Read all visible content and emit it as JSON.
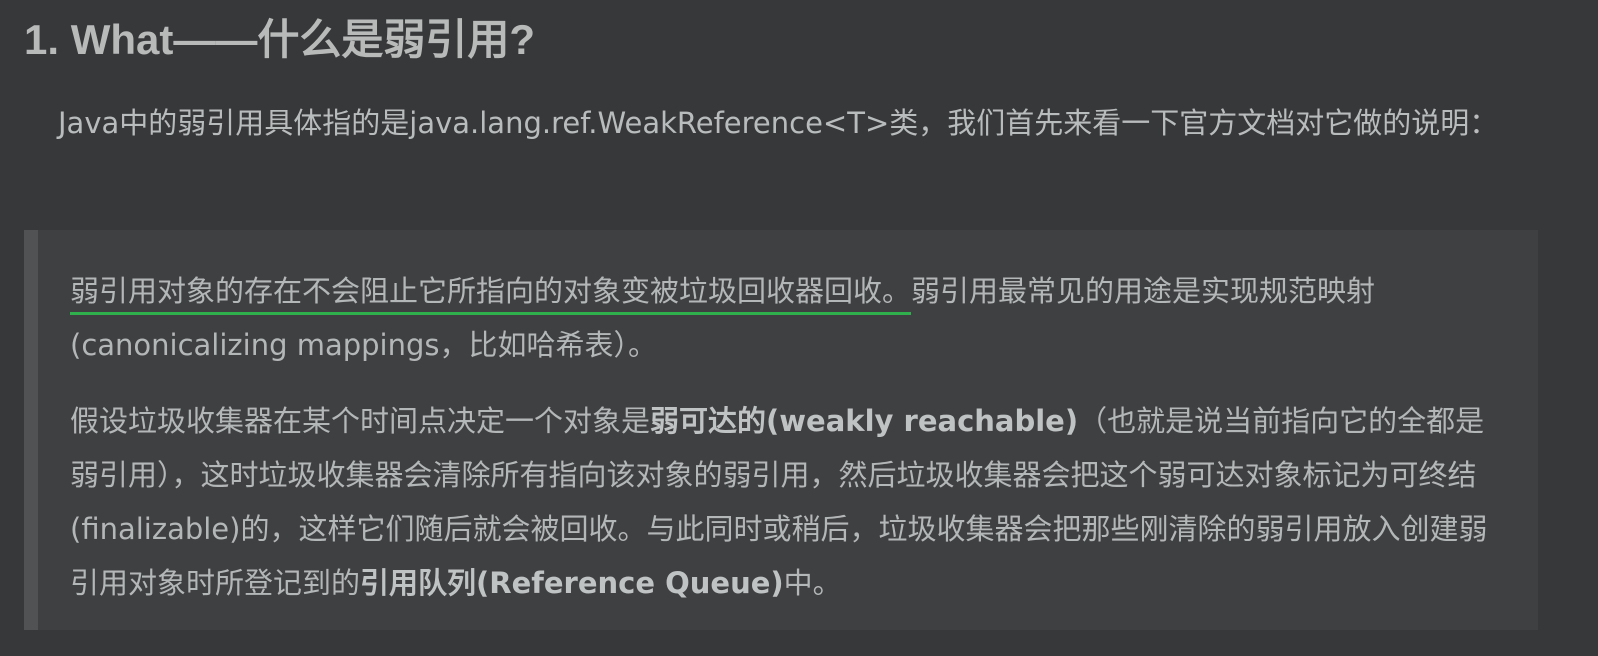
{
  "heading": "1. What——什么是弱引用?",
  "intro": "Java中的弱引用具体指的是java.lang.ref.WeakReference<T>类，我们首先来看一下官方文档对它做的说明：",
  "quote": {
    "p1_underlined": "弱引用对象的存在不会阻止它所指向的对象变被垃圾回收器回收。",
    "p1_rest": "弱引用最常见的用途是实现规范映射(canonicalizing mappings，比如哈希表）。",
    "p2_a": "假设垃圾收集器在某个时间点决定一个对象是",
    "p2_bold1": "弱可达的(weakly reachable)",
    "p2_b": "（也就是说当前指向它的全都是弱引用），这时垃圾收集器会清除所有指向该对象的弱引用，然后垃圾收集器会把这个弱可达对象标记为可终结(finalizable)的，这样它们随后就会被回收。与此同时或稍后，垃圾收集器会把那些刚清除的弱引用放入创建弱引用对象时所登记到的",
    "p2_bold2": "引用队列(Reference Queue)",
    "p2_c": "中。"
  },
  "colors": {
    "background": "#37383a",
    "quote_background": "#3f4042",
    "quote_border": "#505253",
    "underline": "#2fb04d"
  }
}
